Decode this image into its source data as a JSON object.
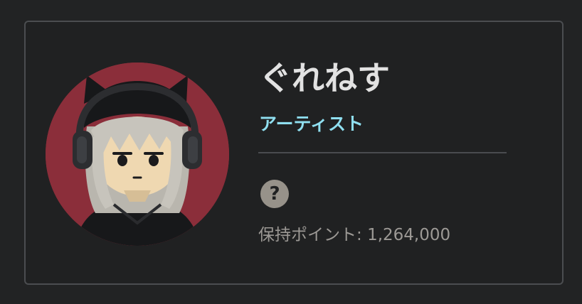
{
  "profile": {
    "name": "ぐれねす",
    "role": "アーティスト",
    "help_icon_glyph": "?",
    "points_label": "保持ポイント: ",
    "points_value": "1,264,000"
  },
  "icons": {
    "help": "help-icon",
    "avatar": "avatar-image"
  },
  "colors": {
    "background": "#222324",
    "card": "#202122",
    "card_border": "#4b4d50",
    "name": "#e2e2e2",
    "role": "#8fdff0",
    "points": "#9c9995",
    "help_icon": "#97928a",
    "avatar_background": "#8b2e3a"
  }
}
